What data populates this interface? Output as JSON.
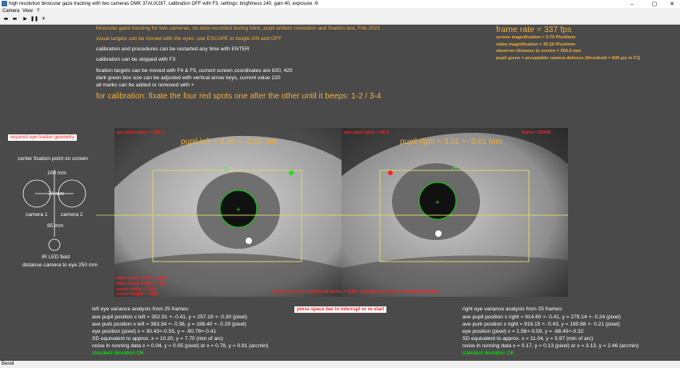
{
  "window": {
    "title": "high resolution binocular gaze tracking with two cameras DMK 37AUX287, calibration OFF with F3, settings: brightness 240, gain 40, exposure -9",
    "minimize": "–",
    "maximize": "▢",
    "close": "✕"
  },
  "menu": {
    "items": [
      "Camera",
      "View",
      "?"
    ]
  },
  "toolbar": {
    "buttons": [
      "▬",
      "▬",
      "▶",
      "❚❚",
      "☀"
    ]
  },
  "instructions": {
    "lines": [
      "binocular gaze tracking for two cameras, no data recorded during blink, pupil artifact correction and fixation test, Feb 2021",
      "visual targets can be moved with the eyes: use ESCAPE to toogle ON and OFF",
      "calibration and procedures can be restarted any time with ENTER",
      "calibration can be skipped with F3",
      "fixation targets can be moved with F4 & F5, current screen coordinates are 820, 420",
      "dark green box size can be adjusted with vertical arrow keys, current value 220",
      "all marks can be added or removed with +"
    ],
    "calibration": "for calibration: fixate the four red spots one after the other until it beeps: 1-2 / 3-4"
  },
  "stats": {
    "frame_rate": "frame rate = 337 fps",
    "screen_magnification": "screen magnification = 3.70 Pixel/mm",
    "video_magnification": "video magnification = 35.50 Pixel/mm",
    "observer_distance": "observer distance to screen = 650.0 mm",
    "pupil_green": "pupil green = acceptable camera defocus (threshold = 600 pix in F1)"
  },
  "geometry": {
    "button": "required eye tracker geometry",
    "center": "center fixation point on screen",
    "d100": "100 mm",
    "d70": "70 mm",
    "cam1": "camera 1",
    "cam2": "camera 2",
    "d85": "85 mm",
    "led": "IR LED field",
    "distance": "distance camera to eye 250 mm"
  },
  "left_panel": {
    "ave_pixel": "ave pixel value = 118.7",
    "pupil": "pupil left = 3.09 +- 0.00 mm",
    "frame_width": "video frame width = 1280",
    "frame_height": "video frame height = 480",
    "screen_width": "screen width = 1920",
    "screen_height": "screen height = 1080"
  },
  "right_panel": {
    "ave_pixel": "ave pixel value = 95.4",
    "frame_label": "frame = 55408",
    "pupil": "pupil right = 3.01 +- 0.01 mm"
  },
  "threshold_note": "pupil detection threshold factor = 0.60, change with arrow key left and right",
  "restart_button": "press space bar to interrupt or re-start",
  "left_analysis": {
    "lines": [
      "left eye variance analysis from 25 frames:",
      "ave pupil position x left = 352.91 +- 0.41, y = 257.19 +- 0.30  (pixel)",
      "ave purk position x left = 383.34 +- 0.36, y = 186.40 +- 0.29 (pixel)",
      "eye position (pixel) x = 30.43+-0.55, y = -90.78+-0.41",
      "SD equivalent to approx. x = 10.20, y = 7.70 (min of arc)",
      "noise in running data x = 0.04, y = 0.05 (pixel) or x = 0.78, y = 0.91 (arcmin)"
    ],
    "ok": "standard deviation OK"
  },
  "right_analysis": {
    "lines": [
      "right eye variance analysis from 25 frames:",
      "ave pupil position x right = 914.60 +- 0.41, y = 279.14 +- 0.24  (pixel)",
      "ave purk position x right = 916.15 +- 0.43, y = 190.68 +- 0.21 (pixel)",
      "eye position (pixel) x = 1.56+-0.59, y = -88.45+-0.32",
      "SD equivalent to approx. x = 11.04, y = 5.97 (min of arc)",
      "noise in running data x = 0.17, y = 0.13 (pixel) or x = 3.13, y = 2.46 (arcmin)"
    ],
    "ok": "standard deviation OK"
  },
  "status": "Bereit"
}
